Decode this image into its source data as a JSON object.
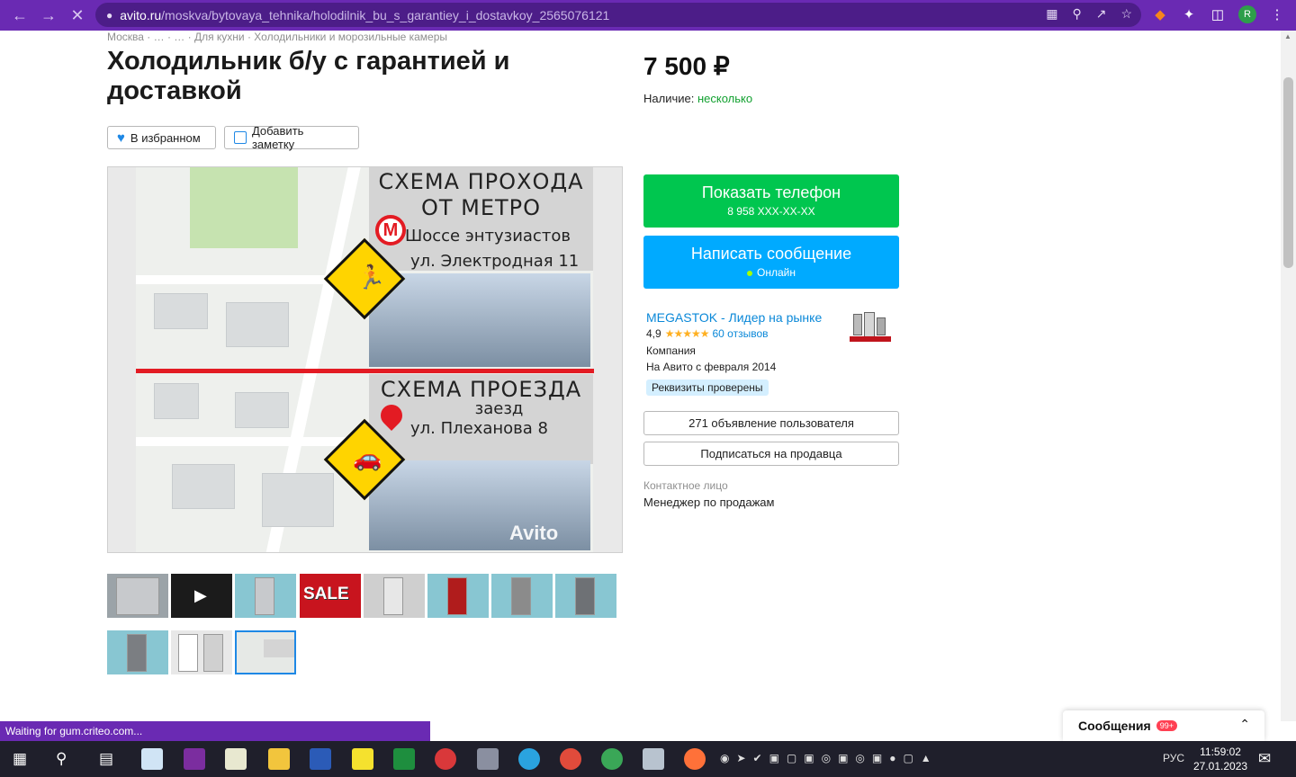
{
  "browser": {
    "url_host": "avito.ru",
    "url_path": "/moskva/bytovaya_tehnika/holodilnik_bu_s_garantiey_i_dostavkoy_2565076121",
    "profile_initial": "R",
    "status_text": "Waiting for gum.criteo.com..."
  },
  "breadcrumb": "Москва · … · … · Для кухни · Холодильники и морозильные камеры",
  "listing": {
    "title": "Холодильник б/у с гарантией и доставкой",
    "favorite_label": "В избранном",
    "note_label": "Добавить заметку",
    "price": "7 500 ₽",
    "availability_label": "Наличие:",
    "availability_value": "несколько"
  },
  "image_text": {
    "walk_title_1": "СХЕМА ПРОХОДА",
    "walk_title_2": "ОТ МЕТРО",
    "metro_letter": "М",
    "metro_station": "Шоссе энтузиастов",
    "walk_address": "ул. Электродная 11",
    "drive_title": "СХЕМА ПРОЕЗДА",
    "drive_entry": "заезд",
    "drive_address": "ул. Плеханова 8",
    "watermark": "Avito",
    "sale_thumb": "SALE"
  },
  "contact": {
    "phone_button": "Показать телефон",
    "phone_masked": "8 958 XXX-XX-XX",
    "message_button": "Написать сообщение",
    "online_status": "Онлайн"
  },
  "seller": {
    "name": "MEGASTOK - Лидер на рынке",
    "rating": "4,9",
    "stars": "★★★★★",
    "reviews": "60 отзывов",
    "type": "Компания",
    "since": "На Авито с февраля 2014",
    "verified": "Реквизиты проверены",
    "ads_button": "271 объявление пользователя",
    "subscribe_button": "Подписаться на продавца",
    "contact_label": "Контактное лицо",
    "contact_value": "Менеджер по продажам"
  },
  "messages_widget": {
    "label": "Сообщения",
    "badge": "99+"
  },
  "taskbar": {
    "language": "РУС",
    "time": "11:59:02",
    "date": "27.01.2023"
  }
}
